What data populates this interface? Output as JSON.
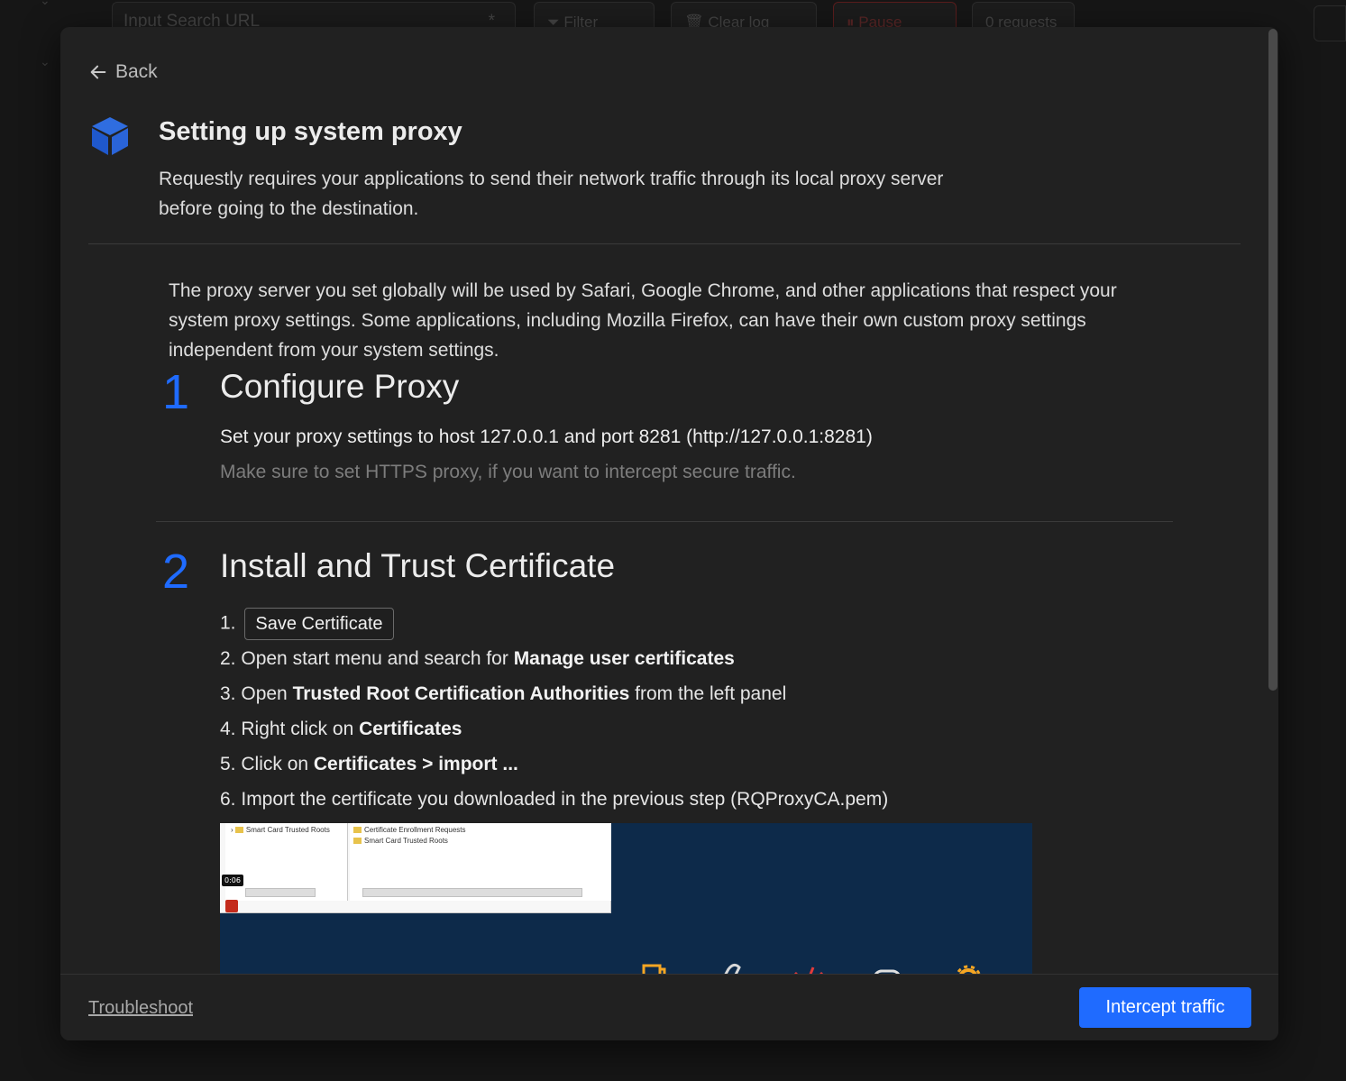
{
  "background": {
    "search_placeholder": "Input Search URL",
    "filter_label": "Filter",
    "clear_label": "Clear log",
    "pause_label": "Pause",
    "requests_label": "0 requests"
  },
  "modal": {
    "back_label": "Back",
    "title": "Setting up system proxy",
    "subtitle": "Requestly requires your applications to send their network traffic through its local proxy server before going to the destination.",
    "intro": "The proxy server you set globally will be used by Safari, Google Chrome, and other applications that respect your system proxy settings. Some applications, including Mozilla Firefox, can have their own custom proxy settings independent from your system settings.",
    "step1": {
      "number": "1",
      "title": "Configure Proxy",
      "instruction": "Set your proxy settings to host 127.0.0.1 and port 8281 (http://127.0.0.1:8281)",
      "hint": "Make sure to set HTTPS proxy, if you want to intercept secure traffic."
    },
    "step2": {
      "number": "2",
      "title": "Install and Trust Certificate",
      "items": [
        {
          "num": "1.",
          "button": "Save Certificate"
        },
        {
          "num": "2.",
          "pre": "Open start menu and search for ",
          "bold": "Manage user certificates",
          "post": ""
        },
        {
          "num": "3.",
          "pre": "Open ",
          "bold": "Trusted Root Certification Authorities",
          "post": " from the left panel"
        },
        {
          "num": "4.",
          "pre": "Right click on ",
          "bold": "Certificates",
          "post": ""
        },
        {
          "num": "5.",
          "pre": "Click on ",
          "bold": "Certificates > import ...",
          "post": ""
        },
        {
          "num": "6.",
          "pre": "Import the certificate you downloaded in the previous step (RQProxyCA.pem)",
          "bold": "",
          "post": ""
        }
      ]
    },
    "video": {
      "left_tree_item": "Smart Card Trusted Roots",
      "right_items": [
        "Certificate Enrollment Requests",
        "Smart Card Trusted Roots"
      ],
      "timestamp": "0:06"
    },
    "footer": {
      "troubleshoot_label": "Troubleshoot",
      "intercept_label": "Intercept traffic"
    }
  },
  "colors": {
    "accent": "#1f6bff",
    "modal_bg": "#212121"
  }
}
